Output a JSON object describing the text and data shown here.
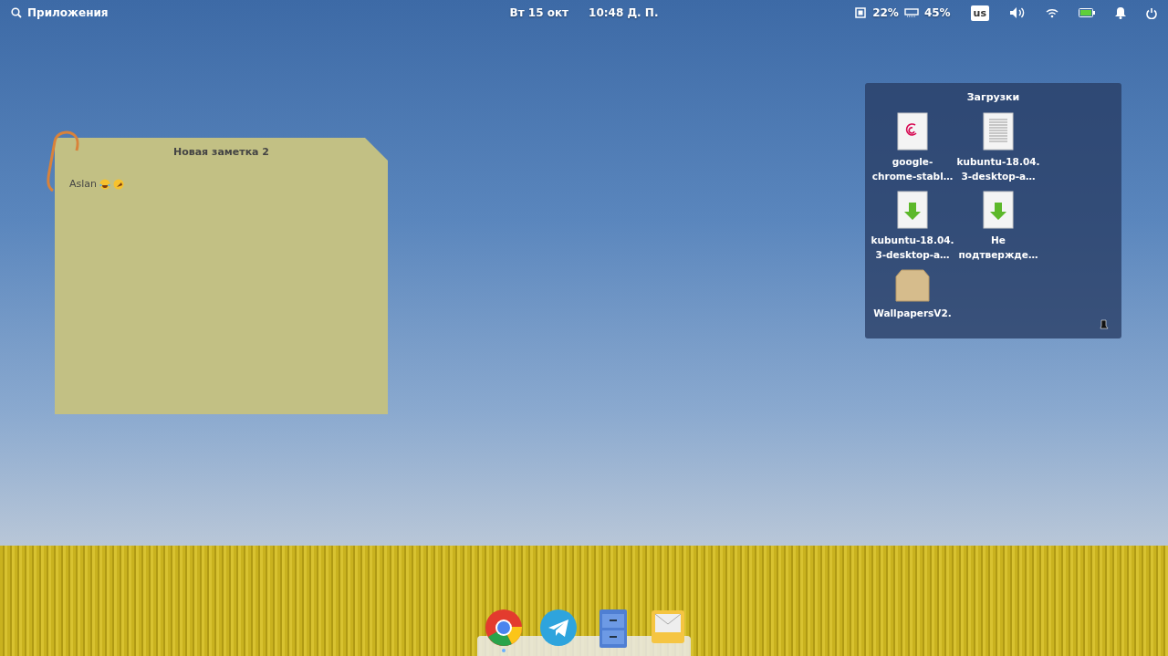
{
  "panel": {
    "apps_label": "Приложения",
    "date": "Вт 15 окт",
    "time": "10:48 Д. П.",
    "cpu": "22%",
    "ram": "45%",
    "keyboard": "us"
  },
  "note": {
    "title": "Новая заметка 2",
    "text": "Aslan",
    "emojis": [
      {
        "kind": "laugh"
      },
      {
        "kind": "rofl"
      }
    ]
  },
  "folder": {
    "title": "Загрузки",
    "items": [
      {
        "kind": "debian",
        "lines": [
          "google-",
          "chrome-stabl…"
        ]
      },
      {
        "kind": "text",
        "lines": [
          "kubuntu-18.04.",
          "3-desktop-a…"
        ]
      },
      {
        "kind": "download",
        "lines": [
          "kubuntu-18.04.",
          "3-desktop-a…"
        ]
      },
      {
        "kind": "download",
        "lines": [
          "Не",
          "подтвержде…"
        ]
      },
      {
        "kind": "package",
        "lines": [
          "WallpapersV2."
        ]
      }
    ]
  },
  "dock": [
    {
      "kind": "browser",
      "running": true
    },
    {
      "kind": "telegram",
      "running": false
    },
    {
      "kind": "files",
      "running": false
    },
    {
      "kind": "mail",
      "running": false
    }
  ]
}
